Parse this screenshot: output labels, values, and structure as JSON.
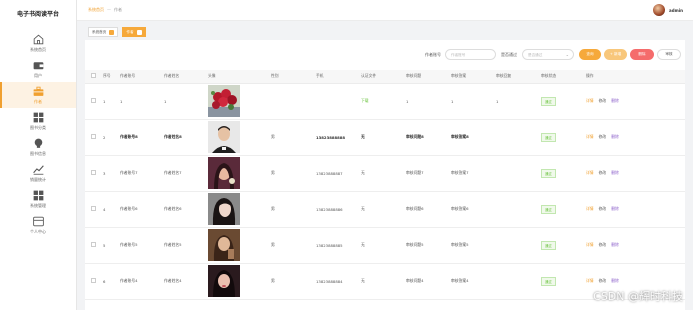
{
  "app": {
    "title": "电子书阅读平台"
  },
  "nav": [
    {
      "label": "系统首页",
      "icon": "home-icon"
    },
    {
      "label": "用户",
      "icon": "wallet-icon"
    },
    {
      "label": "作者",
      "icon": "briefcase-icon",
      "active": true
    },
    {
      "label": "图书分类",
      "icon": "grid-icon"
    },
    {
      "label": "图书信息",
      "icon": "bulb-icon"
    },
    {
      "label": "销量统计",
      "icon": "chart-icon"
    },
    {
      "label": "系统管理",
      "icon": "grid-icon"
    },
    {
      "label": "个人中心",
      "icon": "window-icon"
    }
  ],
  "breadcrumb": {
    "home": "系统首页",
    "sep": "—",
    "current": "作者"
  },
  "user": {
    "name": "admin"
  },
  "tabs": [
    {
      "label": "系统首页",
      "active": false
    },
    {
      "label": "作者",
      "active": true
    }
  ],
  "filters": {
    "author_no_label": "作者账号",
    "author_no_placeholder": "作者账号",
    "review_label": "是否通过",
    "review_placeholder": "是否通过"
  },
  "buttons": {
    "search": "查询",
    "add": "+ 新增",
    "delete": "删除",
    "review": "审核"
  },
  "table": {
    "headers": [
      "",
      "序号",
      "作者账号",
      "作者姓名",
      "头像",
      "性别",
      "手机",
      "认证文件",
      "审核问题",
      "审核答案",
      "审核回复",
      "审核状态",
      "操作"
    ],
    "actions": {
      "detail": "详情",
      "edit": "修改",
      "delete": "删除"
    },
    "rows": [
      {
        "index": "1",
        "account": "1",
        "name": "1",
        "photo": "roses",
        "gender": "",
        "phone": "",
        "cert": "下载",
        "question": "1",
        "answer": "1",
        "reply": "1",
        "status": "通过"
      },
      {
        "index": "2",
        "account": "作者账号8",
        "name": "作者姓名8",
        "photo": "man",
        "gender": "男",
        "phone": "13823888888",
        "cert": "无",
        "question": "审核问题8",
        "answer": "审核答案8",
        "reply": "",
        "status": "通过"
      },
      {
        "index": "3",
        "account": "作者账号7",
        "name": "作者姓名7",
        "photo": "girl1",
        "gender": "男",
        "phone": "13823888887",
        "cert": "无",
        "question": "审核问题7",
        "answer": "审核答案7",
        "reply": "",
        "status": "通过"
      },
      {
        "index": "4",
        "account": "作者账号6",
        "name": "作者姓名6",
        "photo": "girl2",
        "gender": "男",
        "phone": "13823888886",
        "cert": "无",
        "question": "审核问题6",
        "answer": "审核答案6",
        "reply": "",
        "status": "通过"
      },
      {
        "index": "5",
        "account": "作者账号5",
        "name": "作者姓名5",
        "photo": "girl3",
        "gender": "男",
        "phone": "13823888885",
        "cert": "无",
        "question": "审核问题5",
        "answer": "审核答案5",
        "reply": "",
        "status": "通过"
      },
      {
        "index": "6",
        "account": "作者账号4",
        "name": "作者姓名4",
        "photo": "girl4",
        "gender": "男",
        "phone": "13823888884",
        "cert": "无",
        "question": "审核问题4",
        "answer": "审核答案4",
        "reply": "",
        "status": "通过"
      }
    ]
  },
  "watermark": "CSDN @辉时科技",
  "colors": {
    "accent": "#f6a93b",
    "danger": "#f56c6c",
    "success": "#67c23a"
  }
}
